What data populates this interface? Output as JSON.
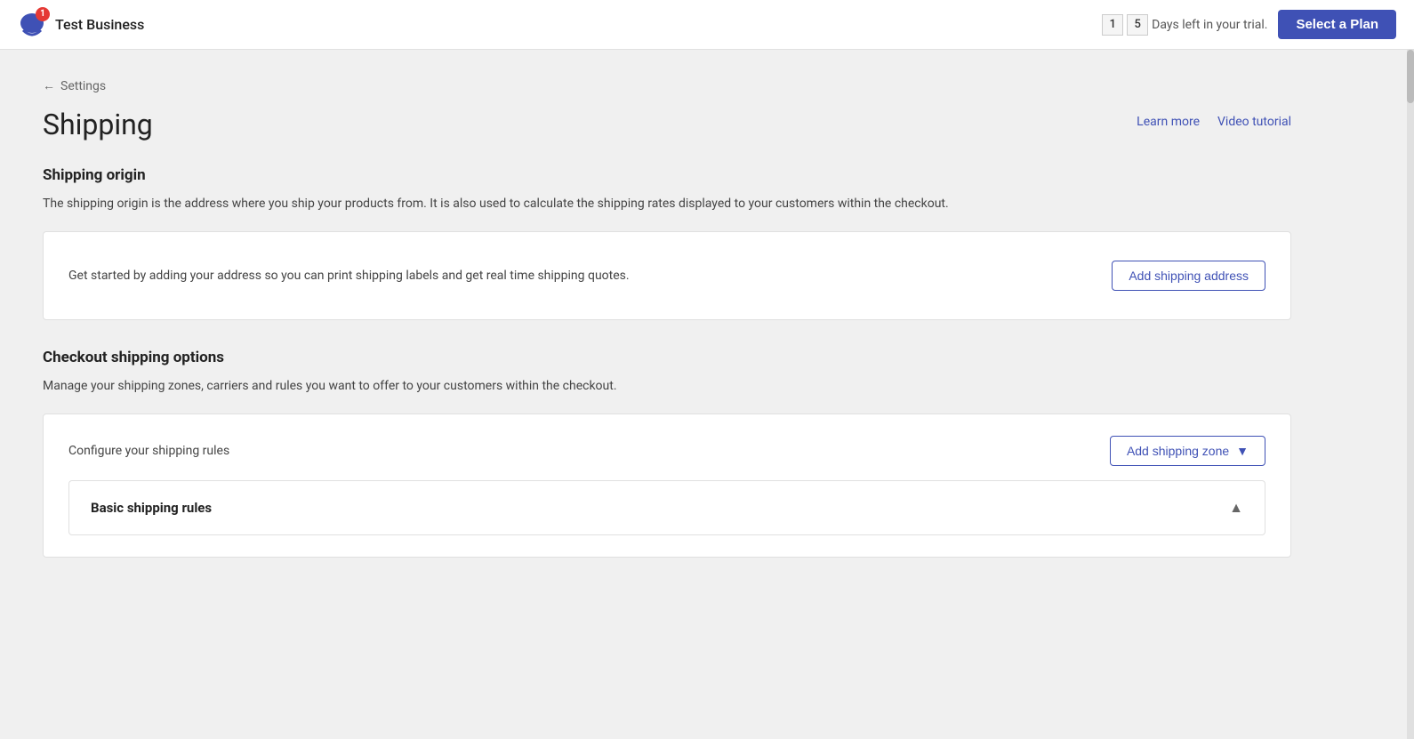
{
  "topnav": {
    "notification_count": "1",
    "business_name": "Test Business",
    "trial_digits": [
      "1",
      "5"
    ],
    "trial_text": "Days left in your trial.",
    "select_plan_label": "Select a Plan"
  },
  "breadcrumb": {
    "back_label": "Settings"
  },
  "page": {
    "title": "Shipping",
    "learn_more_label": "Learn more",
    "video_tutorial_label": "Video tutorial"
  },
  "shipping_origin": {
    "section_title": "Shipping origin",
    "description": "The shipping origin is the address where you ship your products from. It is also used to calculate the shipping rates displayed to your customers within the checkout.",
    "card_text": "Get started by adding your address so you can print shipping labels and get real time shipping quotes.",
    "add_address_label": "Add shipping address"
  },
  "checkout_shipping": {
    "section_title": "Checkout shipping options",
    "description": "Manage your shipping zones, carriers and rules you want to offer to your customers within the checkout.",
    "configure_text": "Configure your shipping rules",
    "add_zone_label": "Add shipping zone",
    "basic_rules_title": "Basic shipping rules"
  }
}
